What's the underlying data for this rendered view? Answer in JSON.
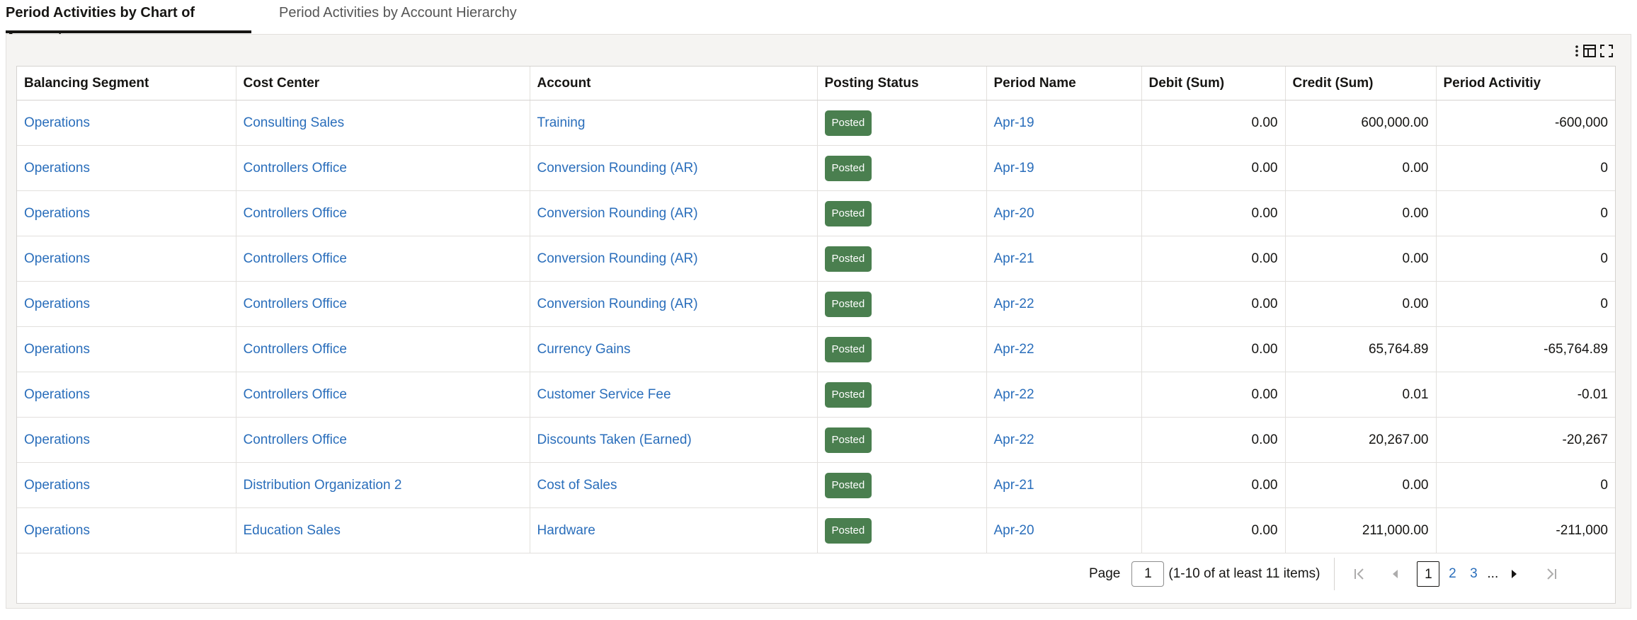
{
  "tabs": [
    {
      "label": "Period Activities by Chart of Accounts",
      "active": true
    },
    {
      "label": "Period Activities by Account Hierarchy",
      "active": false
    }
  ],
  "toolbar_icons": [
    "more-options-icon",
    "column-settings-icon",
    "fullscreen-icon"
  ],
  "table": {
    "columns": [
      "Balancing Segment",
      "Cost Center",
      "Account",
      "Posting Status",
      "Period Name",
      "Debit (Sum)",
      "Credit (Sum)",
      "Period Activitiy"
    ],
    "rows": [
      [
        "Operations",
        "Consulting Sales",
        "Training",
        "Posted",
        "Apr-19",
        "0.00",
        "600,000.00",
        "-600,000"
      ],
      [
        "Operations",
        "Controllers Office",
        "Conversion Rounding (AR)",
        "Posted",
        "Apr-19",
        "0.00",
        "0.00",
        "0"
      ],
      [
        "Operations",
        "Controllers Office",
        "Conversion Rounding (AR)",
        "Posted",
        "Apr-20",
        "0.00",
        "0.00",
        "0"
      ],
      [
        "Operations",
        "Controllers Office",
        "Conversion Rounding (AR)",
        "Posted",
        "Apr-21",
        "0.00",
        "0.00",
        "0"
      ],
      [
        "Operations",
        "Controllers Office",
        "Conversion Rounding (AR)",
        "Posted",
        "Apr-22",
        "0.00",
        "0.00",
        "0"
      ],
      [
        "Operations",
        "Controllers Office",
        "Currency Gains",
        "Posted",
        "Apr-22",
        "0.00",
        "65,764.89",
        "-65,764.89"
      ],
      [
        "Operations",
        "Controllers Office",
        "Customer Service Fee",
        "Posted",
        "Apr-22",
        "0.00",
        "0.01",
        "-0.01"
      ],
      [
        "Operations",
        "Controllers Office",
        "Discounts Taken (Earned)",
        "Posted",
        "Apr-22",
        "0.00",
        "20,267.00",
        "-20,267"
      ],
      [
        "Operations",
        "Distribution Organization 2",
        "Cost of Sales",
        "Posted",
        "Apr-21",
        "0.00",
        "0.00",
        "0"
      ],
      [
        "Operations",
        "Education Sales",
        "Hardware",
        "Posted",
        "Apr-20",
        "0.00",
        "211,000.00",
        "-211,000"
      ]
    ]
  },
  "pagination": {
    "label": "Page",
    "current_value": "1",
    "range_text": "(1-10 of at least 11 items)",
    "pages": [
      "1",
      "2",
      "3"
    ],
    "ellipsis": "..."
  },
  "colors": {
    "link": "#2a6ebb",
    "posted_badge": "#4a7f4f"
  }
}
